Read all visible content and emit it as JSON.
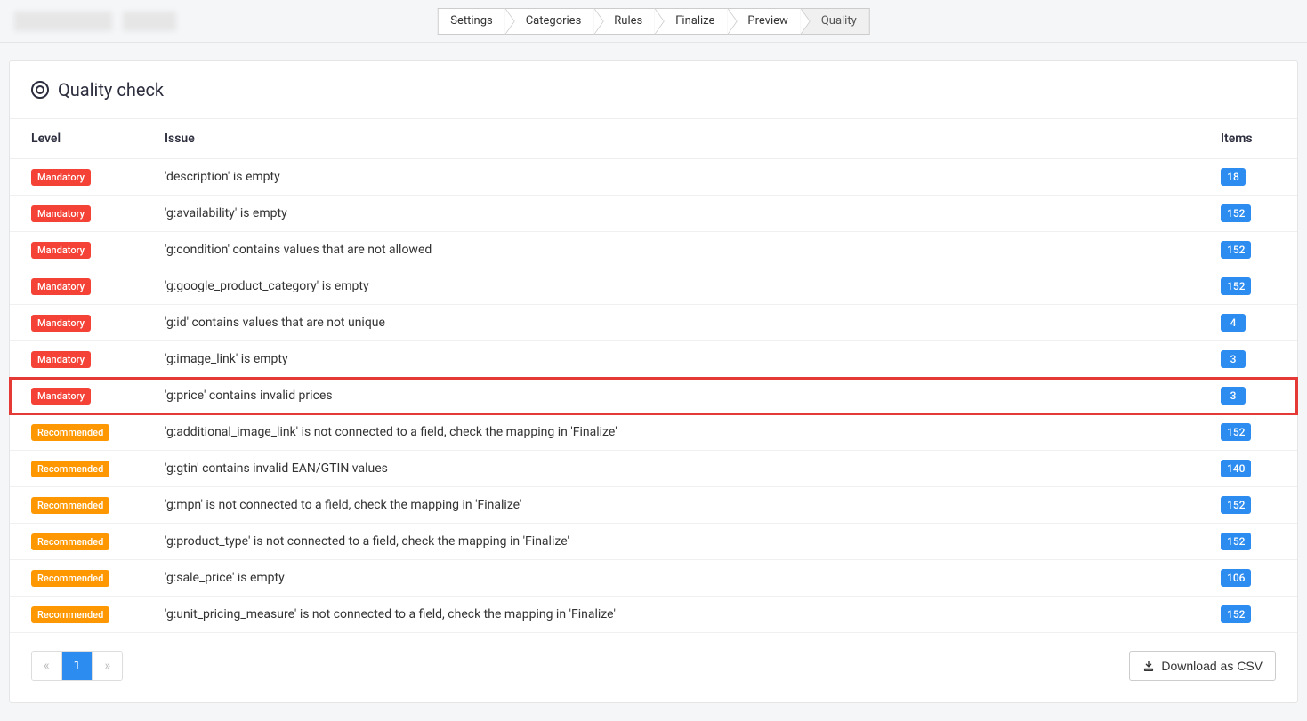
{
  "wizard": {
    "steps": [
      "Settings",
      "Categories",
      "Rules",
      "Finalize",
      "Preview",
      "Quality"
    ],
    "active_index": 5
  },
  "panel": {
    "title": "Quality check"
  },
  "table": {
    "headers": {
      "level": "Level",
      "issue": "Issue",
      "items": "Items"
    },
    "rows": [
      {
        "level": "Mandatory",
        "level_class": "badge-mandatory",
        "issue": "'description' is empty",
        "items": "18",
        "highlight": false
      },
      {
        "level": "Mandatory",
        "level_class": "badge-mandatory",
        "issue": "'g:availability' is empty",
        "items": "152",
        "highlight": false
      },
      {
        "level": "Mandatory",
        "level_class": "badge-mandatory",
        "issue": "'g:condition' contains values that are not allowed",
        "items": "152",
        "highlight": false
      },
      {
        "level": "Mandatory",
        "level_class": "badge-mandatory",
        "issue": "'g:google_product_category' is empty",
        "items": "152",
        "highlight": false
      },
      {
        "level": "Mandatory",
        "level_class": "badge-mandatory",
        "issue": "'g:id' contains values that are not unique",
        "items": "4",
        "highlight": false
      },
      {
        "level": "Mandatory",
        "level_class": "badge-mandatory",
        "issue": "'g:image_link' is empty",
        "items": "3",
        "highlight": false
      },
      {
        "level": "Mandatory",
        "level_class": "badge-mandatory",
        "issue": "'g:price' contains invalid prices",
        "items": "3",
        "highlight": true
      },
      {
        "level": "Recommended",
        "level_class": "badge-recommended",
        "issue": "'g:additional_image_link' is not connected to a field, check the mapping in 'Finalize'",
        "items": "152",
        "highlight": false
      },
      {
        "level": "Recommended",
        "level_class": "badge-recommended",
        "issue": "'g:gtin' contains invalid EAN/GTIN values",
        "items": "140",
        "highlight": false
      },
      {
        "level": "Recommended",
        "level_class": "badge-recommended",
        "issue": "'g:mpn' is not connected to a field, check the mapping in 'Finalize'",
        "items": "152",
        "highlight": false
      },
      {
        "level": "Recommended",
        "level_class": "badge-recommended",
        "issue": "'g:product_type' is not connected to a field, check the mapping in 'Finalize'",
        "items": "152",
        "highlight": false
      },
      {
        "level": "Recommended",
        "level_class": "badge-recommended",
        "issue": "'g:sale_price' is empty",
        "items": "106",
        "highlight": false
      },
      {
        "level": "Recommended",
        "level_class": "badge-recommended",
        "issue": "'g:unit_pricing_measure' is not connected to a field, check the mapping in 'Finalize'",
        "items": "152",
        "highlight": false
      }
    ]
  },
  "pagination": {
    "prev": "«",
    "pages": [
      "1"
    ],
    "active_page": "1",
    "next": "»"
  },
  "download_button": "Download as CSV"
}
